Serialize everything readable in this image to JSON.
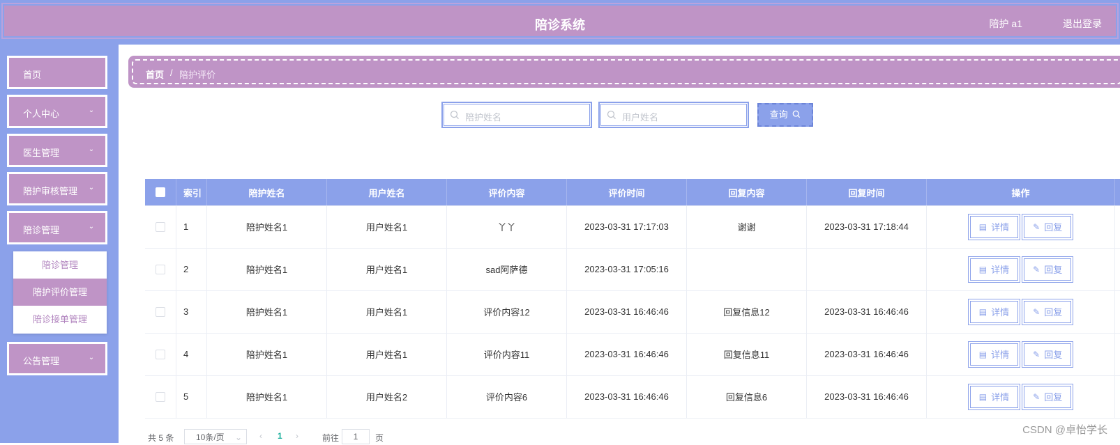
{
  "header": {
    "title": "陪诊系统",
    "user": "陪护 a1",
    "logout": "退出登录",
    "colors": {
      "header_bg": "#bf94c6",
      "accent": "#8ba1ea"
    }
  },
  "sidebar": {
    "items": [
      {
        "label": "首页",
        "expandable": false
      },
      {
        "label": "个人中心",
        "expandable": true
      },
      {
        "label": "医生管理",
        "expandable": true
      },
      {
        "label": "陪护审核管理",
        "expandable": true
      },
      {
        "label": "陪诊管理",
        "expandable": true
      },
      {
        "label": "公告管理",
        "expandable": true
      }
    ],
    "submenu": [
      "陪诊管理",
      "陪护评价管理",
      "陪诊接单管理"
    ],
    "active_submenu": "陪护评价管理"
  },
  "breadcrumb": {
    "home": "首页",
    "separator": "/",
    "current": "陪护评价"
  },
  "search": {
    "escort_placeholder": "陪护姓名",
    "user_placeholder": "用户姓名",
    "query_label": "查询"
  },
  "table": {
    "headers": [
      "索引",
      "陪护姓名",
      "用户姓名",
      "评价内容",
      "评价时间",
      "回复内容",
      "回复时间",
      "操作"
    ],
    "detail_label": "详情",
    "reply_label": "回复",
    "rows": [
      {
        "index": "1",
        "escort": "陪护姓名1",
        "user": "用户姓名1",
        "content": "丫丫",
        "time": "2023-03-31 17:17:03",
        "reply": "谢谢",
        "reply_time": "2023-03-31 17:18:44"
      },
      {
        "index": "2",
        "escort": "陪护姓名1",
        "user": "用户姓名1",
        "content": "sad阿萨德",
        "time": "2023-03-31 17:05:16",
        "reply": "",
        "reply_time": ""
      },
      {
        "index": "3",
        "escort": "陪护姓名1",
        "user": "用户姓名1",
        "content": "评价内容12",
        "time": "2023-03-31 16:46:46",
        "reply": "回复信息12",
        "reply_time": "2023-03-31 16:46:46"
      },
      {
        "index": "4",
        "escort": "陪护姓名1",
        "user": "用户姓名1",
        "content": "评价内容11",
        "time": "2023-03-31 16:46:46",
        "reply": "回复信息11",
        "reply_time": "2023-03-31 16:46:46"
      },
      {
        "index": "5",
        "escort": "陪护姓名1",
        "user": "用户姓名2",
        "content": "评价内容6",
        "time": "2023-03-31 16:46:46",
        "reply": "回复信息6",
        "reply_time": "2023-03-31 16:46:46"
      }
    ]
  },
  "pagination": {
    "total": "共 5 条",
    "page_size": "10条/页",
    "current_page": "1",
    "goto_label": "前往",
    "goto_value": "1",
    "page_suffix": "页"
  },
  "watermark": "CSDN @卓怡学长"
}
